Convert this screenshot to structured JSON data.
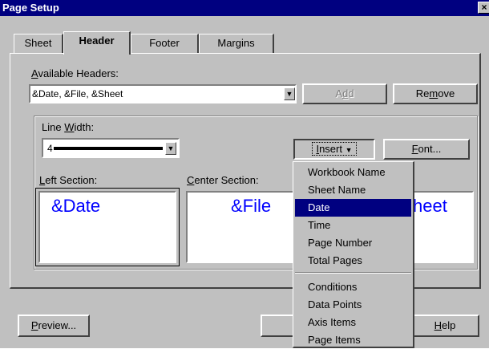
{
  "window": {
    "title": "Page Setup",
    "close_glyph": "×"
  },
  "tabs": [
    {
      "label": "Sheet"
    },
    {
      "label": "Header"
    },
    {
      "label": "Footer"
    },
    {
      "label": "Margins"
    }
  ],
  "available_headers": {
    "label_pre": "",
    "label_ul": "A",
    "label_post": "vailable Headers:",
    "value": "&Date, &File, &Sheet",
    "add_pre": "A",
    "add_ul": "d",
    "add_post": "d",
    "remove_pre": "Re",
    "remove_ul": "m",
    "remove_post": "ove"
  },
  "line_width": {
    "label_pre": "Line ",
    "label_ul": "W",
    "label_post": "idth:",
    "value": "4"
  },
  "insert_button": {
    "pre": "",
    "ul": "I",
    "post": "nsert",
    "arrow": "▼"
  },
  "font_button": {
    "pre": "",
    "ul": "F",
    "post": "ont..."
  },
  "sections": {
    "left_label_pre": "",
    "left_label_ul": "L",
    "left_label_post": "eft Section:",
    "left_text": "&Date",
    "center_label_pre": "",
    "center_label_ul": "C",
    "center_label_post": "enter Section:",
    "center_text": "&File",
    "right_text": "heet"
  },
  "insert_menu": {
    "items": [
      {
        "label": "Workbook Name"
      },
      {
        "label": "Sheet Name"
      },
      {
        "label": "Date",
        "selected": true
      },
      {
        "label": "Time"
      },
      {
        "label": "Page Number"
      },
      {
        "label": "Total Pages"
      },
      {
        "label": "Conditions"
      },
      {
        "label": "Data Points"
      },
      {
        "label": "Axis Items"
      },
      {
        "label": "Page Items"
      }
    ]
  },
  "footer_buttons": {
    "preview_pre": "",
    "preview_ul": "P",
    "preview_post": "review...",
    "help_pre": "",
    "help_ul": "H",
    "help_post": "elp"
  }
}
